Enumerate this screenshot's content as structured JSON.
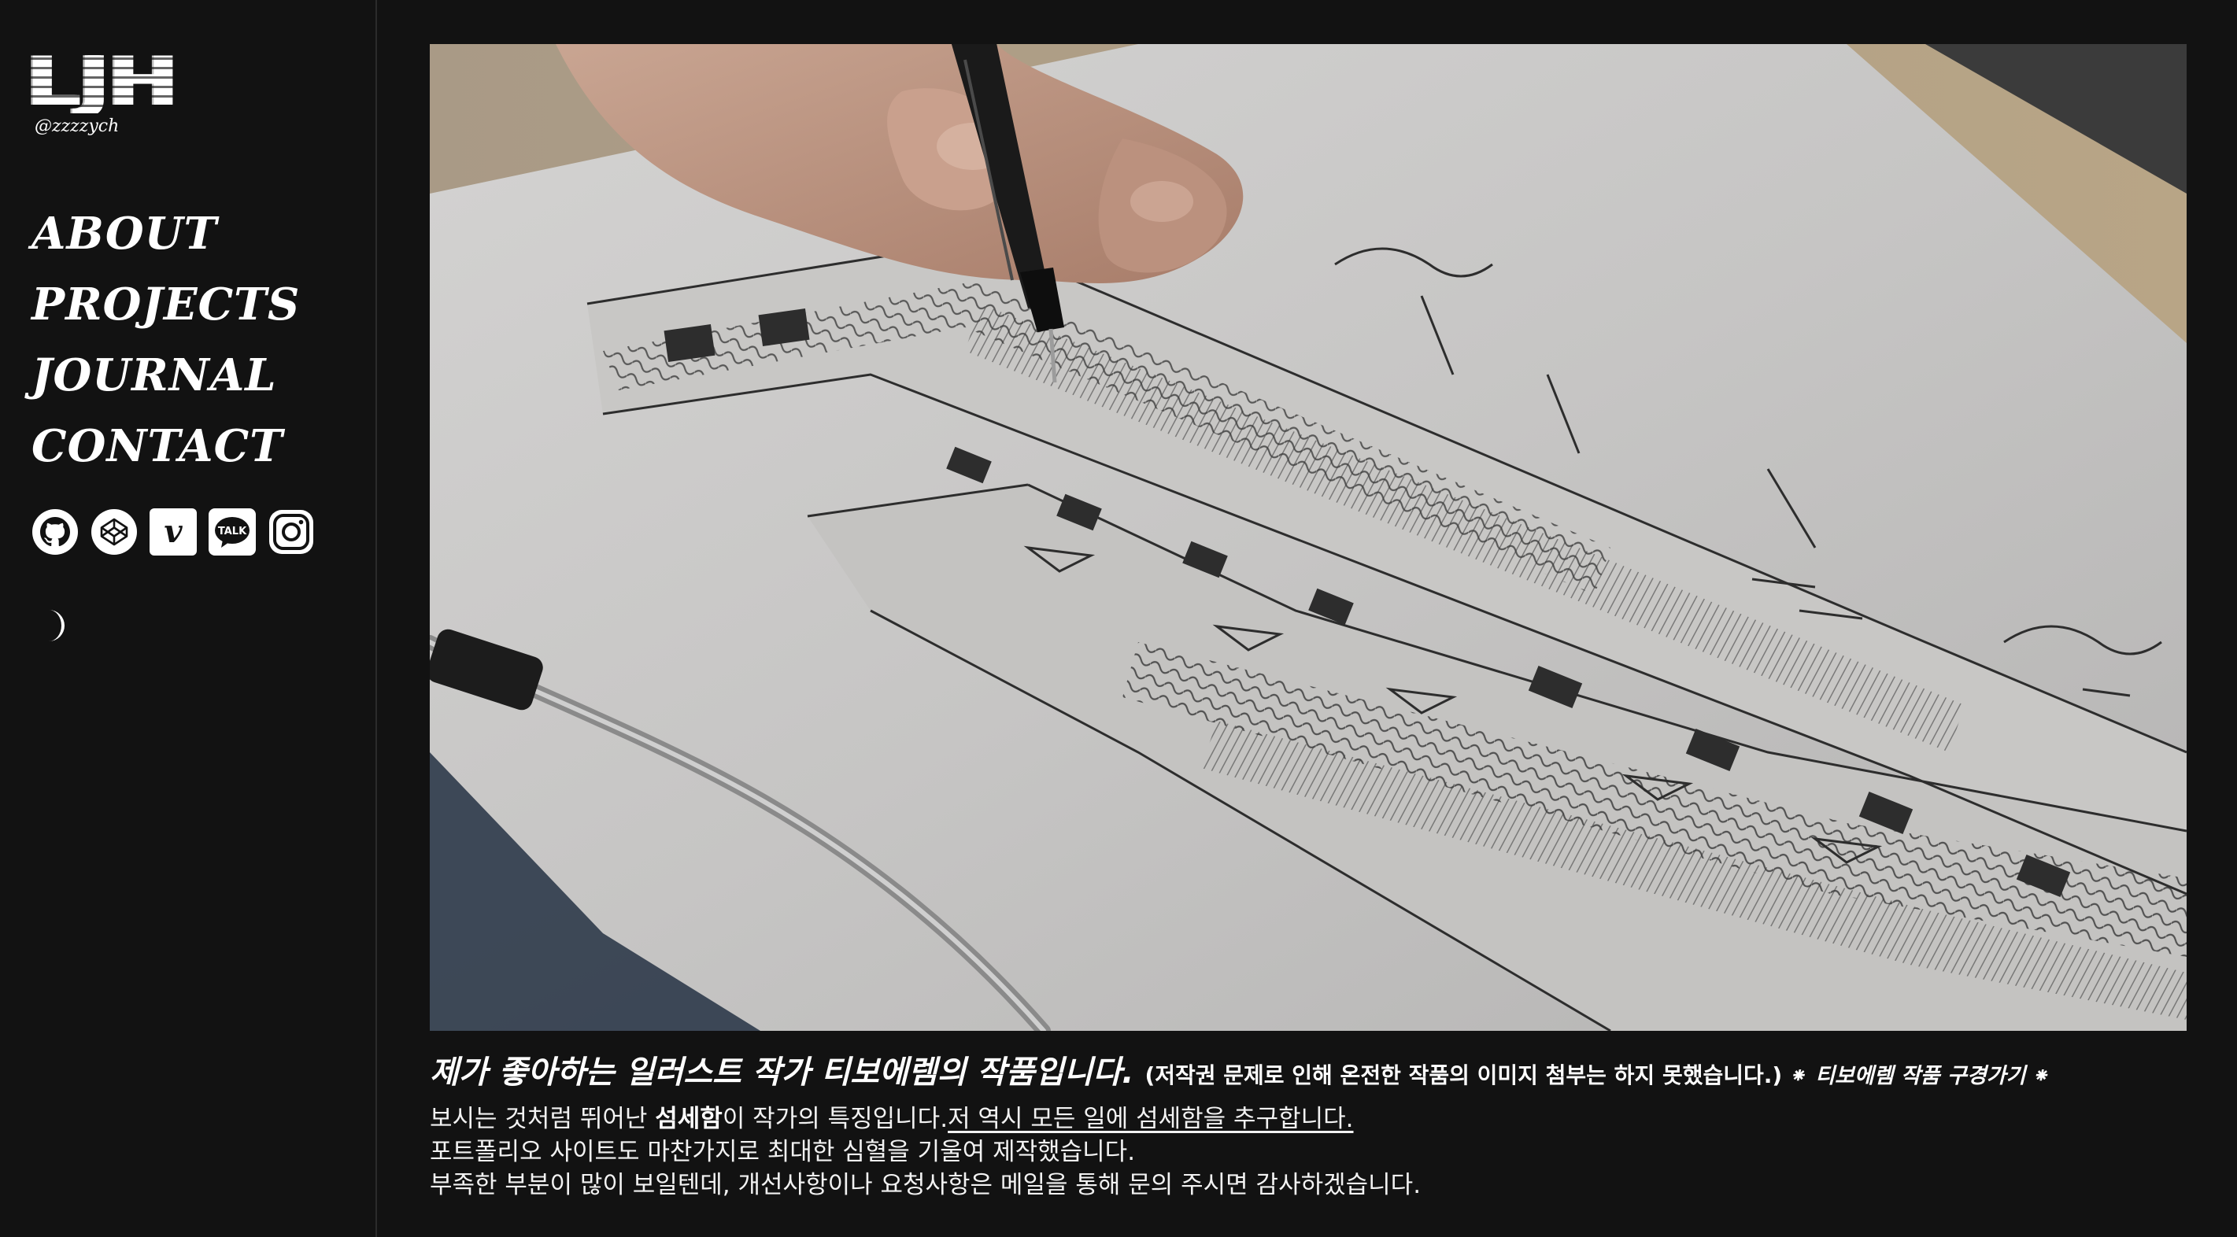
{
  "brand": {
    "logo_text": "LJH",
    "handle": "@zzzzych"
  },
  "nav": {
    "items": [
      {
        "label": "ABOUT"
      },
      {
        "label": "PROJECTS"
      },
      {
        "label": "JOURNAL"
      },
      {
        "label": "CONTACT"
      }
    ]
  },
  "social": {
    "icons": [
      "github-icon",
      "codepen-icon",
      "vimeo-icon",
      "kakaotalk-icon",
      "instagram-icon"
    ],
    "vimeo_glyph": "v",
    "kakao_glyph": "TALK"
  },
  "theme_toggle": {
    "icon": "moon-icon"
  },
  "hero": {
    "image_alt": "pen drawing of a street illustration"
  },
  "caption": {
    "title": "제가 좋아하는 일러스트 작가 티보에렘의 작품입니다.",
    "note": "(저작권 문제로 인해 온전한 작품의 이미지 첨부는 하지 못했습니다.)",
    "link": "⁕ 티보에렘 작품 구경가기 ⁕",
    "line1_pre": "보시는 것처럼 뛰어난 ",
    "line1_bold": "섬세함",
    "line1_mid": "이 작가의 특징입니다.",
    "line1_underline": "저 역시 모든 일에 섬세함을 추구합니다.",
    "line2": "포트폴리오 사이트도 마찬가지로 최대한 심혈을 기울여 제작했습니다.",
    "line3": "부족한 부분이 많이 보일텐데, 개선사항이나 요청사항은 메일을 통해 문의 주시면 감사하겠습니다."
  },
  "colors": {
    "background": "#121212",
    "text": "#ffffff",
    "divider": "#2b2b2b"
  }
}
